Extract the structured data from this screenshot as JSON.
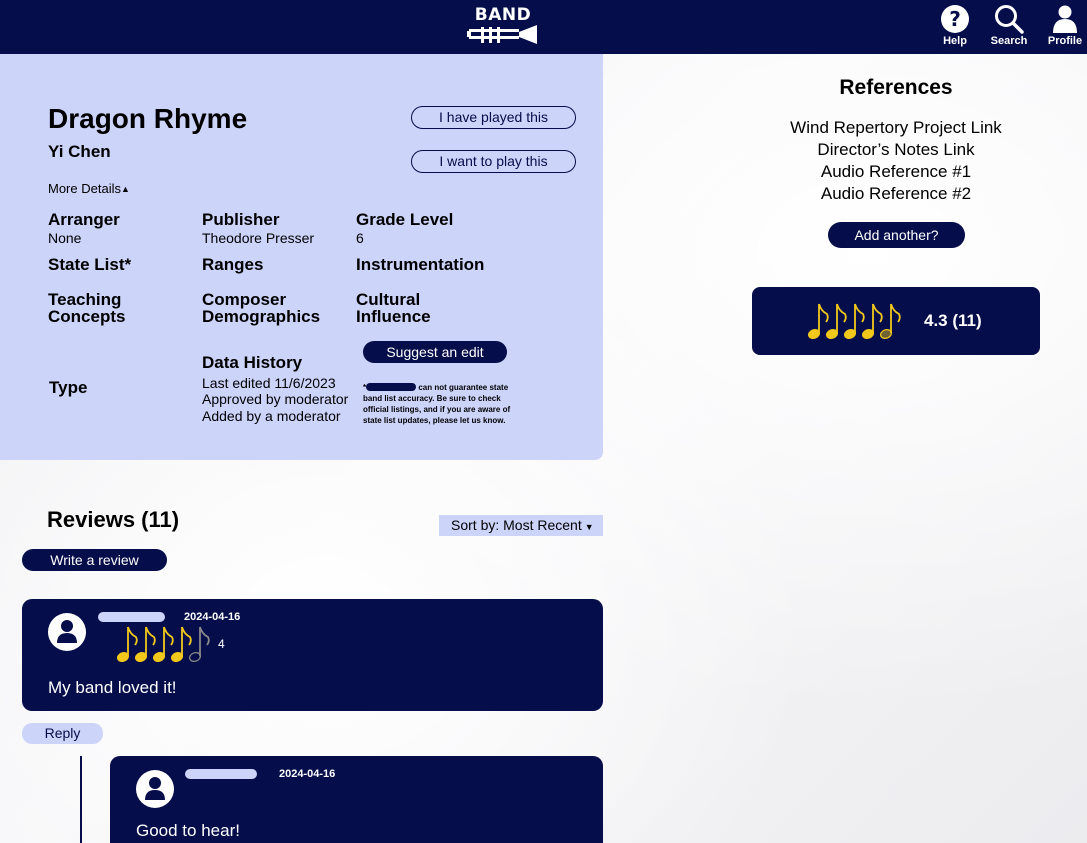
{
  "app": {
    "logo_text": "BAND",
    "nav": [
      {
        "label": "Help",
        "icon": "help-circle-icon"
      },
      {
        "label": "Search",
        "icon": "search-icon"
      },
      {
        "label": "Profile",
        "icon": "person-icon"
      }
    ]
  },
  "colors": {
    "navy": "#050d4a",
    "lavender": "#cdd4fa",
    "note_gold": "#f2c81a"
  },
  "piece": {
    "title": "Dragon Rhyme",
    "composer": "Yi Chen",
    "played_label": "I have played this",
    "want_label": "I want to play this",
    "more_details_label": "More Details",
    "fields": {
      "arranger_label": "Arranger",
      "arranger_value": "None",
      "publisher_label": "Publisher",
      "publisher_value": "Theodore Presser",
      "grade_label": "Grade Level",
      "grade_value": "6",
      "state_list_label": "State List*",
      "ranges_label": "Ranges",
      "instrumentation_label": "Instrumentation",
      "teaching_label_1": "Teaching",
      "teaching_label_2": "Concepts",
      "composer_demo_label_1": "Composer",
      "composer_demo_label_2": "Demographics",
      "cultural_label_1": "Cultural",
      "cultural_label_2": "Influence",
      "type_label": "Type"
    },
    "data_history": {
      "label": "Data History",
      "lines": [
        "Last edited 11/6/2023",
        "Approved by moderator",
        "Added by a moderator"
      ]
    },
    "suggest_edit_label": "Suggest an edit",
    "disclaimer_prefix": "*",
    "disclaimer_text": " can not guarantee state band list accuracy. Be sure to check official listings, and if you are aware of state list updates, please let us know."
  },
  "references": {
    "title": "References",
    "links": [
      "Wind Repertory Project Link",
      "Director’s Notes Link",
      "Audio Reference #1",
      "Audio Reference #2"
    ],
    "add_label": "Add another?"
  },
  "rating": {
    "value": 4.3,
    "text": "4.3 (11)",
    "max": 5
  },
  "reviews": {
    "title": "Reviews (11)",
    "sort_label": "Sort by: Most Recent",
    "write_label": "Write a review",
    "reply_label": "Reply",
    "items": [
      {
        "date": "2024-04-16",
        "rating": 4,
        "score_text": "4",
        "body": "My band loved it!"
      },
      {
        "date": "2024-04-16",
        "body": "Good to hear!"
      }
    ]
  }
}
